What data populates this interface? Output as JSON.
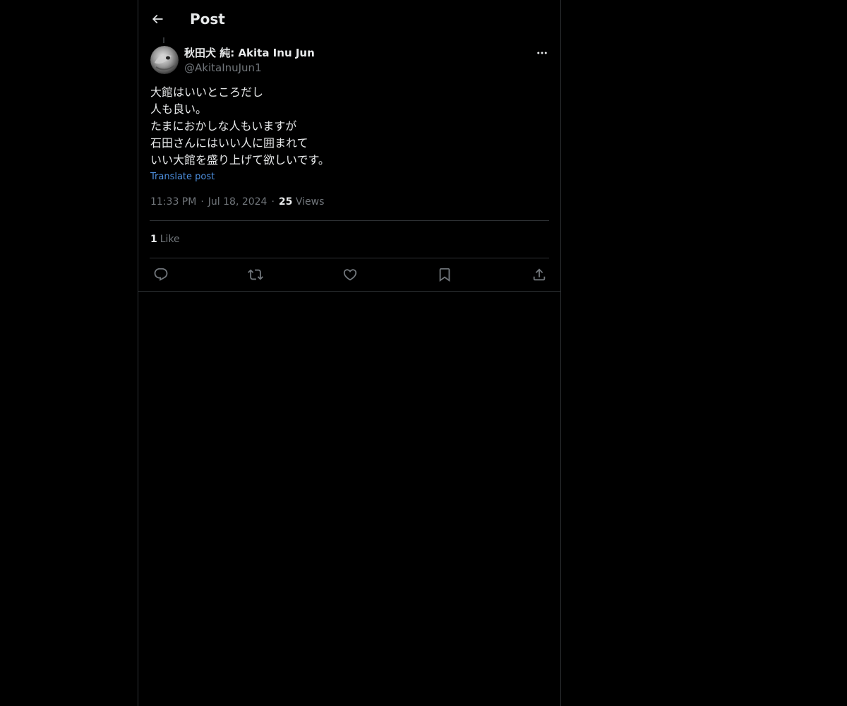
{
  "header": {
    "title": "Post"
  },
  "author": {
    "display_name": "秋田犬 純: Akita Inu Jun",
    "handle": "@AkitaInuJun1"
  },
  "post": {
    "lines": [
      "大館はいいところだし",
      "人も良い。",
      "たまにおかしな人もいますが",
      "石田さんにはいい人に囲まれて",
      "いい大館を盛り上げて欲しいです。"
    ],
    "translate_label": "Translate post",
    "time": "11:33 PM",
    "date": "Jul 18, 2024",
    "views_count": "25",
    "views_label": "Views",
    "likes_count": "1",
    "likes_label": "Like"
  },
  "icons": {
    "back": "arrow-left-icon",
    "more": "more-horizontal-icon",
    "reply": "reply-icon",
    "repost": "repost-icon",
    "like": "heart-icon",
    "bookmark": "bookmark-icon",
    "share": "share-icon"
  },
  "colors": {
    "background": "#000000",
    "text_primary": "#e7e9ea",
    "text_secondary": "#71767b",
    "link": "#4d8fde",
    "border": "#2f3336"
  }
}
